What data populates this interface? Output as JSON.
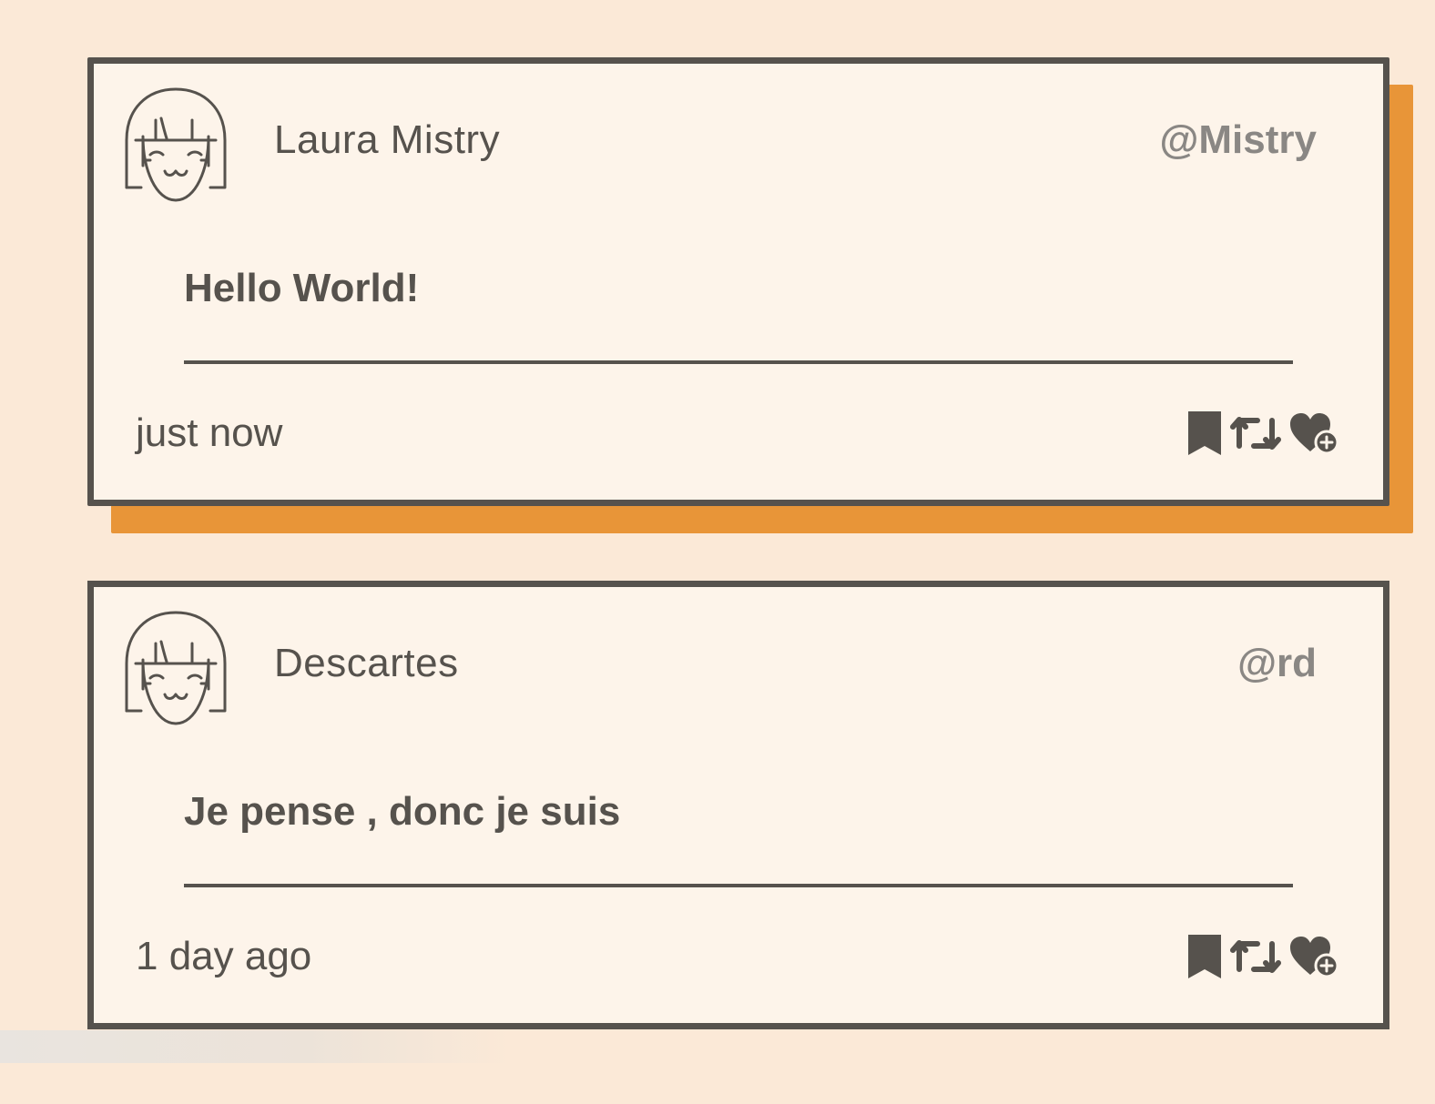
{
  "posts": [
    {
      "name": "Laura Mistry",
      "handle": "@Mistry",
      "text": "Hello World!",
      "time": "just now"
    },
    {
      "name": "Descartes",
      "handle": "@rd",
      "text": "Je pense , donc je suis",
      "time": "1 day ago"
    }
  ],
  "colors": {
    "background": "#fbe9d7",
    "card": "#fdf4ea",
    "border": "#56524d",
    "accent_shadow": "#e89538",
    "handle": "#8a8784"
  },
  "icons": [
    "avatar-icon",
    "bookmark-icon",
    "retweet-icon",
    "heart-add-icon"
  ]
}
